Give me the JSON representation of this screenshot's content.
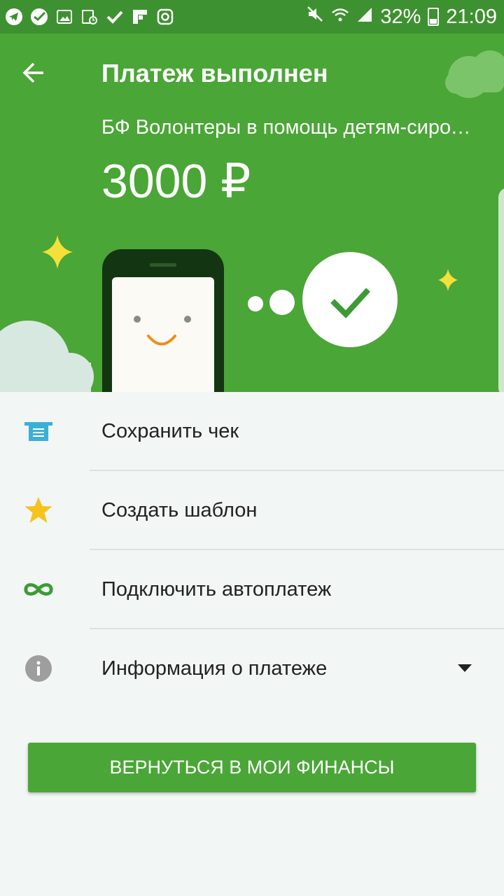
{
  "status_bar": {
    "battery": "32%",
    "time": "21:09",
    "icons": [
      "telegram-icon",
      "sberbank-icon",
      "gallery-icon",
      "calendar-clock-icon",
      "check-icon",
      "flipboard-icon",
      "instagram-icon",
      "mute-icon",
      "wifi-icon",
      "signal-icon",
      "battery-icon"
    ]
  },
  "header": {
    "title": "Платеж выполнен",
    "recipient": "БФ Волонтеры в помощь детям-сиротам",
    "amount": "3000 ₽"
  },
  "actions": [
    {
      "label": "Сохранить чек",
      "icon": "receipt-icon"
    },
    {
      "label": "Создать шаблон",
      "icon": "star-icon"
    },
    {
      "label": "Подключить автоплатеж",
      "icon": "infinity-icon"
    },
    {
      "label": "Информация о платеже",
      "icon": "info-icon"
    }
  ],
  "return_button": "ВЕРНУТЬСЯ В МОИ ФИНАНСЫ",
  "colors": {
    "status_bar": "#3e9130",
    "header": "#4aa636",
    "background": "#f2f6f5",
    "button": "#4aa636",
    "receipt_icon": "#3ab0d9",
    "star_icon": "#f5c31c",
    "infinity_icon": "#3d9b35",
    "info_icon": "#9e9e9e"
  }
}
